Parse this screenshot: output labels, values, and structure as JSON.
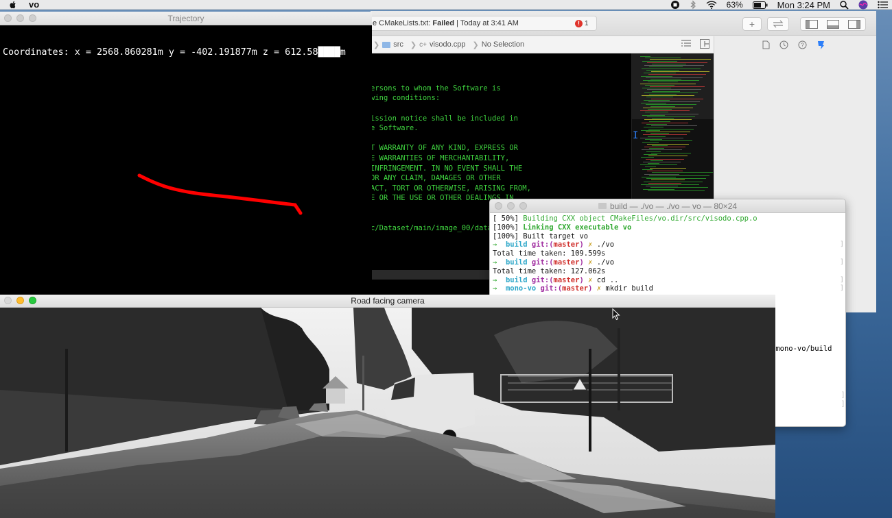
{
  "menubar": {
    "app_name": "vo",
    "battery_percent": "63%",
    "clock": "Mon 3:24 PM",
    "icons": [
      "apple-icon",
      "record-icon",
      "bluetooth-icon",
      "wifi-icon",
      "battery-icon",
      "spotlight-icon",
      "siri-icon",
      "menu-list-icon"
    ]
  },
  "xcode": {
    "status_prefix": "e CMakeLists.txt:",
    "status_state": "Failed",
    "status_time": "| Today at 3:41 AM",
    "error_count": "1",
    "breadcrumb_folder": "src",
    "breadcrumb_file": "visodo.cpp",
    "breadcrumb_selection": "No Selection",
    "code_lines": [
      "ersons to whom the Software is",
      "wing conditions:",
      "",
      "ission notice shall be included in",
      "e Software.",
      "",
      "T WARRANTY OF ANY KIND, EXPRESS OR",
      "E WARRANTIES OF MERCHANTABILITY,",
      "INFRINGEMENT. IN NO EVENT SHALL THE",
      "OR ANY CLAIM, DAMAGES OR OTHER",
      "ACT, TORT OR OTHERWISE, ARISING FROM,",
      "E OR THE USE OR OTHER DEALINGS IN",
      "",
      "",
      "c/Dataset/main/image_00/data/"
    ],
    "colors": {
      "code_text": "#3fd33f",
      "error": "#e0332b",
      "accent": "#2d7ff9"
    }
  },
  "terminal": {
    "title": "build — ./vo — ./vo — vo — 80×24",
    "lines": [
      {
        "prefix": "[ 50%] ",
        "text": "Building CXX object CMakeFiles/vo.dir/src/visodo.cpp.o",
        "style": "g"
      },
      {
        "prefix": "[100%] ",
        "text": "Linking CXX executable vo",
        "style": "gb"
      },
      {
        "prefix": "[100%] ",
        "text": "Built target vo",
        "style": "plain"
      },
      {
        "dir": "build",
        "branch": "master",
        "cmd": "./vo"
      },
      {
        "prefix": "",
        "text": "Total time taken: 109.599s",
        "style": "plain"
      },
      {
        "dir": "build",
        "branch": "master",
        "cmd": "./vo"
      },
      {
        "prefix": "",
        "text": "Total time taken: 127.062s",
        "style": "plain"
      },
      {
        "dir": "build",
        "branch": "master",
        "cmd": "cd .."
      },
      {
        "dir": "mono-vo",
        "branch": "master",
        "cmd": "mkdir build"
      }
    ],
    "partial_path": "/mono-vo/build"
  },
  "trajectory": {
    "title": "Trajectory",
    "coordinates_text": "Coordinates: x = 2568.860281m y = -402.191877m z = 612.58████m",
    "path_color": "#ff0000"
  },
  "camera": {
    "title": "Road facing camera"
  }
}
